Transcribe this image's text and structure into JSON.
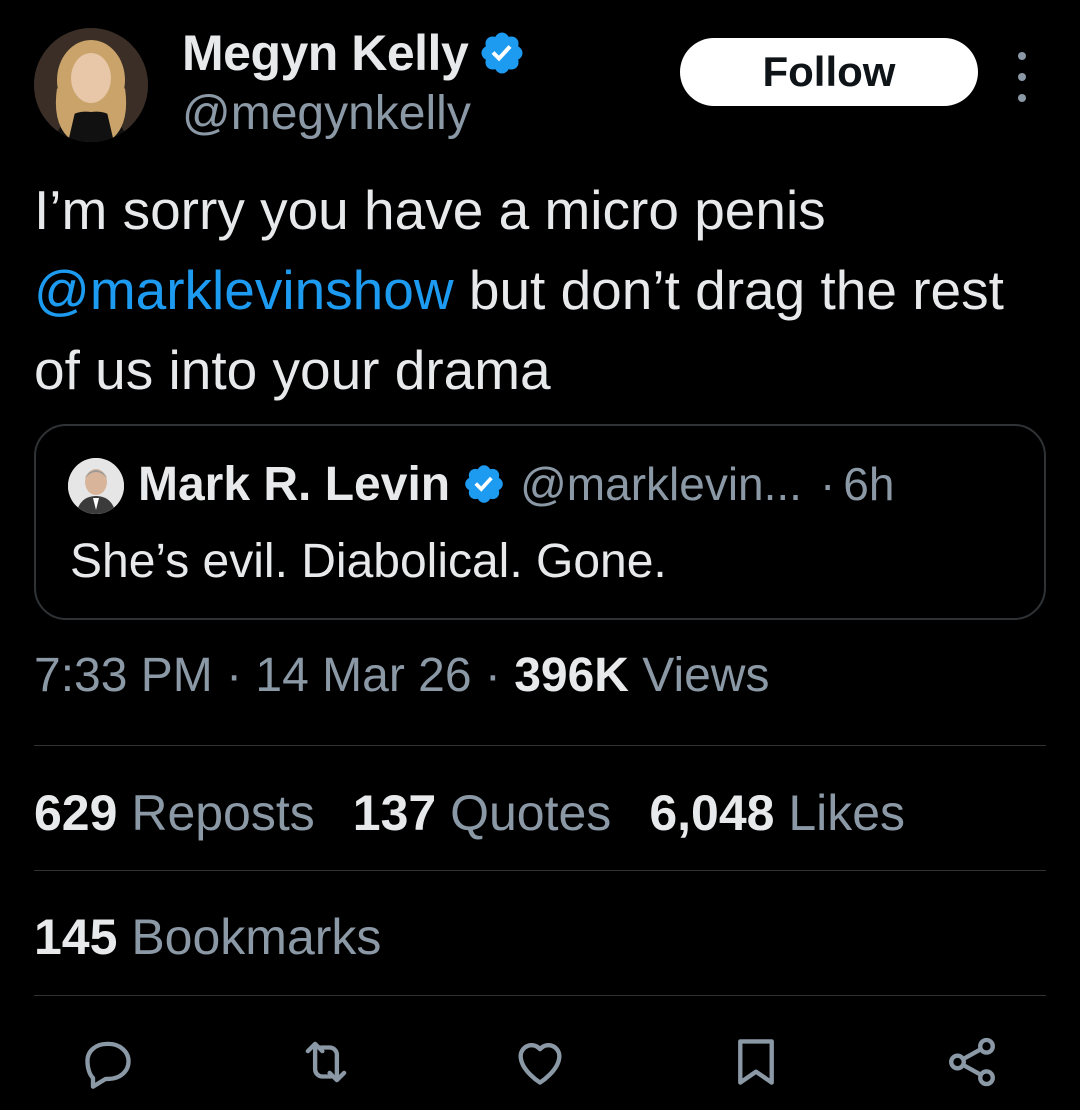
{
  "author": {
    "display_name": "Megyn Kelly",
    "handle": "@megynkelly",
    "verified": true
  },
  "follow_label": "Follow",
  "tweet": {
    "text_before": "I’m sorry you have a micro penis ",
    "mention": "@marklevinshow",
    "text_after": " but don’t drag the rest of us into your drama"
  },
  "quoted": {
    "display_name": "Mark R. Levin",
    "handle": "@marklevin...",
    "separator": "·",
    "time_ago": "6h",
    "text": "She’s evil. Diabolical. Gone."
  },
  "meta": {
    "time": "7:33 PM",
    "sep1": " · ",
    "date": "14 Mar 26",
    "sep2": " · ",
    "views_count": "396K",
    "views_label": " Views"
  },
  "stats": {
    "reposts_count": "629",
    "reposts_label": " Reposts",
    "quotes_count": "137",
    "quotes_label": " Quotes",
    "likes_count": "6,048",
    "likes_label": " Likes",
    "bookmarks_count": "145",
    "bookmarks_label": " Bookmarks"
  },
  "colors": {
    "background": "#000000",
    "accent": "#1d9bf0",
    "text": "#e7e9ea",
    "secondary": "#8b98a5",
    "border": "#2f3336"
  },
  "icons": [
    "reply-icon",
    "repost-icon",
    "like-icon",
    "bookmark-icon",
    "share-icon"
  ]
}
